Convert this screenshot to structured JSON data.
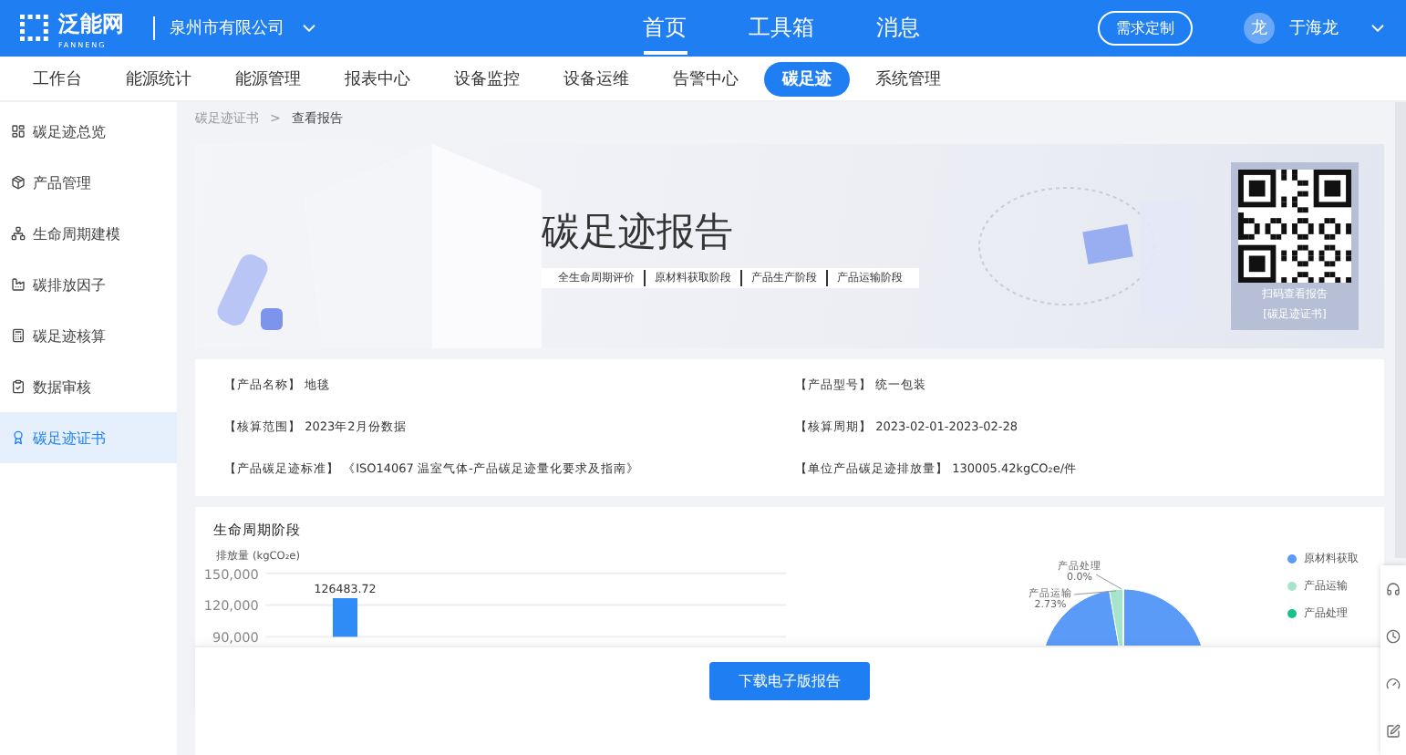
{
  "header": {
    "logo": {
      "name": "泛能网",
      "subtitle": "FANNENG"
    },
    "company": "泉州市有限公司",
    "nav": [
      {
        "label": "首页",
        "selected": true
      },
      {
        "label": "工具箱",
        "selected": false
      },
      {
        "label": "消息",
        "selected": false
      }
    ],
    "action_button": "需求定制",
    "user": {
      "avatar": "龙",
      "name": "于海龙"
    }
  },
  "menu": [
    {
      "label": "工作台",
      "selected": false
    },
    {
      "label": "能源统计",
      "selected": false
    },
    {
      "label": "能源管理",
      "selected": false
    },
    {
      "label": "报表中心",
      "selected": false
    },
    {
      "label": "设备监控",
      "selected": false
    },
    {
      "label": "设备运维",
      "selected": false
    },
    {
      "label": "告警中心",
      "selected": false
    },
    {
      "label": "碳足迹",
      "selected": true
    },
    {
      "label": "系统管理",
      "selected": false
    }
  ],
  "sidebar": {
    "items": [
      {
        "label": "碳足迹总览",
        "selected": false
      },
      {
        "label": "产品管理",
        "selected": false
      },
      {
        "label": "生命周期建模",
        "selected": false
      },
      {
        "label": "碳排放因子",
        "selected": false
      },
      {
        "label": "碳足迹核算",
        "selected": false
      },
      {
        "label": "数据审核",
        "selected": false
      },
      {
        "label": "碳足迹证书",
        "selected": true
      }
    ]
  },
  "breadcrumb": {
    "items": [
      "碳足迹证书",
      "查看报告"
    ],
    "separator": ">"
  },
  "banner": {
    "title": "碳足迹报告",
    "tags": [
      "全生命周期评价",
      "原材料获取阶段",
      "产品生产阶段",
      "产品运输阶段"
    ],
    "qr_caption": [
      "扫码查看报告",
      "[碳足迹证书]"
    ]
  },
  "info": [
    {
      "label": "【产品名称】",
      "value": "地毯"
    },
    {
      "label": "【产品型号】",
      "value": "统一包装"
    },
    {
      "label": "【核算范围】",
      "value": "2023年2月份数据"
    },
    {
      "label": "【核算周期】",
      "value": "2023-02-01-2023-02-28"
    },
    {
      "label": "【产品碳足迹标准】",
      "value": "《ISO14067 温室气体-产品碳足迹量化要求及指南》"
    },
    {
      "label": "【单位产品碳足迹排放量】",
      "value": "130005.42kgCO₂e/件"
    }
  ],
  "chart_section": {
    "title": "生命周期阶段",
    "bar_chart": {
      "chart_data": {
        "type": "bar",
        "ylabel": "排放量 (kgCO₂e)",
        "values": [
          126483.72
        ],
        "ylim": [
          90000,
          150000
        ],
        "yticks": [
          {
            "value": 90000,
            "label": "90,000"
          },
          {
            "value": 120000,
            "label": "120,000"
          },
          {
            "value": 150000,
            "label": "150,000"
          }
        ],
        "data_labels": true
      }
    },
    "pie_chart": {
      "chart_data": {
        "type": "pie",
        "categories": [
          "原材料获取",
          "产品运输",
          "产品处理"
        ],
        "values": [
          97.27,
          2.73,
          0.0
        ],
        "colors": [
          "#5b9bf8",
          "#a6e4cc",
          "#18c08c"
        ],
        "value_labels": [
          null,
          "2.73%",
          "0.0%"
        ]
      }
    }
  },
  "download_button": "下载电子版报告"
}
